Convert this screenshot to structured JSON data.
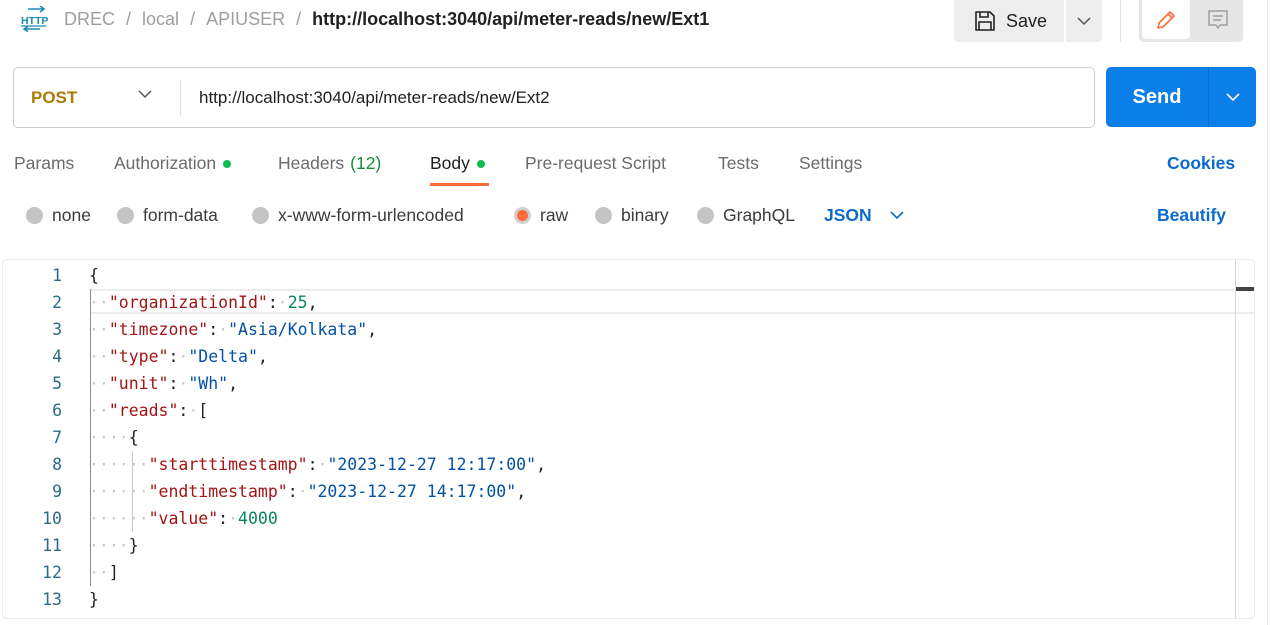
{
  "header": {
    "breadcrumb": [
      "DREC",
      "local",
      "APIUSER"
    ],
    "current": "http://localhost:3040/api/meter-reads/new/Ext1",
    "save_label": "Save",
    "icons": {
      "http": "http-request-icon",
      "save": "floppy-disk-icon",
      "caret": "chevron-down-icon",
      "edit": "pencil-icon",
      "comment": "comment-icon"
    }
  },
  "request": {
    "method": "POST",
    "url": "http://localhost:3040/api/meter-reads/new/Ext2",
    "send_label": "Send",
    "method_color": "#ad7a03",
    "send_color": "#0c7ee8"
  },
  "tabs": {
    "items": [
      {
        "label": "Params"
      },
      {
        "label": "Authorization",
        "dot": true
      },
      {
        "label": "Headers",
        "count": "(12)"
      },
      {
        "label": "Body",
        "dot": true,
        "active": true
      },
      {
        "label": "Pre-request Script"
      },
      {
        "label": "Tests"
      },
      {
        "label": "Settings"
      }
    ],
    "cookies_label": "Cookies",
    "active_color": "#ff6c37"
  },
  "body_types": {
    "options": [
      "none",
      "form-data",
      "x-www-form-urlencoded",
      "raw",
      "binary",
      "GraphQL"
    ],
    "selected": "raw",
    "format": "JSON",
    "beautify_label": "Beautify"
  },
  "editor": {
    "line_numbers": [
      "1",
      "2",
      "3",
      "4",
      "5",
      "6",
      "7",
      "8",
      "9",
      "10",
      "11",
      "12",
      "13"
    ],
    "lines": [
      "{",
      "  \"organizationId\": 25,",
      "  \"timezone\": \"Asia/Kolkata\",",
      "  \"type\": \"Delta\",",
      "  \"unit\": \"Wh\",",
      "  \"reads\": [",
      "    {",
      "      \"starttimestamp\": \"2023-12-27 12:17:00\",",
      "      \"endtimestamp\": \"2023-12-27 14:17:00\",",
      "      \"value\": 4000",
      "    }",
      "  ]",
      "}"
    ],
    "tokens": {
      "organizationId_key": "\"organizationId\"",
      "organizationId_val": "25",
      "timezone_key": "\"timezone\"",
      "timezone_val": "\"Asia/Kolkata\"",
      "type_key": "\"type\"",
      "type_val": "\"Delta\"",
      "unit_key": "\"unit\"",
      "unit_val": "\"Wh\"",
      "reads_key": "\"reads\"",
      "start_key": "\"starttimestamp\"",
      "start_val": "\"2023-12-27 12:17:00\"",
      "end_key": "\"endtimestamp\"",
      "end_val": "\"2023-12-27 14:17:00\"",
      "value_key": "\"value\"",
      "value_val": "4000"
    }
  }
}
